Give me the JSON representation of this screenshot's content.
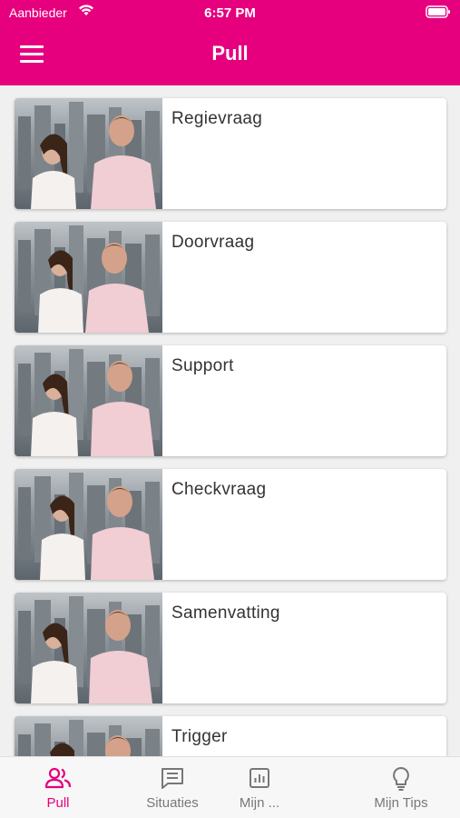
{
  "status_bar": {
    "carrier": "Aanbieder",
    "time": "6:57 PM"
  },
  "appbar": {
    "title": "Pull",
    "menu_icon": "hamburger-menu-icon"
  },
  "items": [
    {
      "title": "Regievraag"
    },
    {
      "title": "Doorvraag"
    },
    {
      "title": "Support"
    },
    {
      "title": "Checkvraag"
    },
    {
      "title": "Samenvatting"
    },
    {
      "title": "Trigger"
    }
  ],
  "bottom_nav": [
    {
      "label": "Pull",
      "icon": "people-icon",
      "active": true
    },
    {
      "label": "Situaties",
      "icon": "message-icon",
      "active": false
    },
    {
      "label": "Mijn ...",
      "icon": "chart-icon",
      "active": false
    },
    {
      "label": "Mijn Tips",
      "icon": "lightbulb-icon",
      "active": false
    }
  ],
  "colors": {
    "accent": "#e6007e",
    "inactive": "#777777"
  }
}
